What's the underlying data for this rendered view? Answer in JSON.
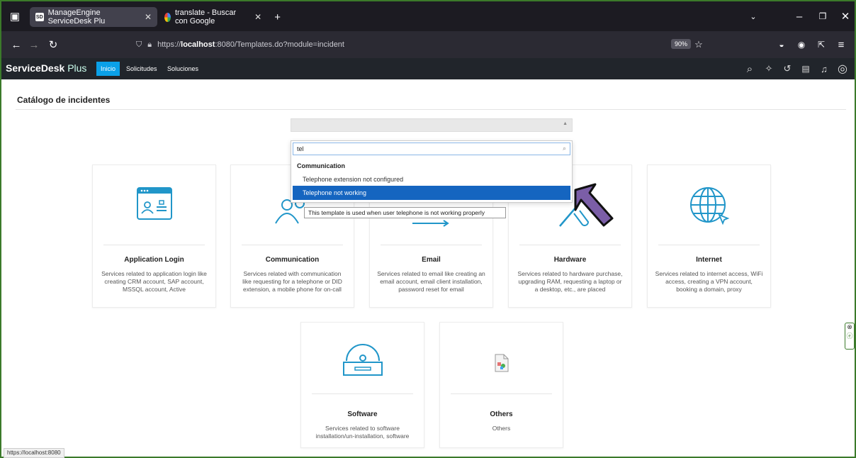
{
  "browser": {
    "tabs": [
      {
        "label": "ManageEngine ServiceDesk Plu",
        "favicon": "SD"
      },
      {
        "label": "translate - Buscar con Google"
      }
    ],
    "url_prefix": "https://",
    "url_host": "localhost",
    "url_rest": ":8080/Templates.do?module=incident",
    "zoom": "90%",
    "status_url": "https://localhost:8080"
  },
  "app": {
    "brand": "ServiceDesk",
    "brand_suffix": "Plus",
    "menu": [
      "Inicio",
      "Solicitudes",
      "Soluciones"
    ]
  },
  "page": {
    "title": "Catálogo de incidentes"
  },
  "dropdown": {
    "search_value": "tel",
    "group": "Communication",
    "options": [
      "Telephone extension not configured",
      "Telephone not working"
    ],
    "selected_index": 1,
    "tooltip": "This template is used when user telephone is not working properly"
  },
  "cards": [
    {
      "title": "Application Login",
      "desc": "Services related to application login like creating CRM account, SAP account, MSSQL account, Active",
      "icon": "app-login-icon"
    },
    {
      "title": "Communication",
      "desc": "Services related with communication like requesting for a telephone or DID extension, a mobile phone for on-call",
      "icon": "users-icon"
    },
    {
      "title": "Email",
      "desc": "Services related to email like creating an email account, email client installation, password reset for email",
      "icon": "email-icon"
    },
    {
      "title": "Hardware",
      "desc": "Services related to hardware purchase, upgrading RAM, requesting a laptop or a desktop, etc., are placed",
      "icon": "tools-icon"
    },
    {
      "title": "Internet",
      "desc": "Services related to internet access, WiFi access, creating a VPN account, booking a domain, proxy",
      "icon": "globe-icon"
    },
    {
      "title": "Software",
      "desc": "Services related to software installation/un-installation, software",
      "icon": "disc-drive-icon"
    },
    {
      "title": "Others",
      "desc": "Others",
      "icon": "broken-image-icon"
    }
  ],
  "colors": {
    "accent": "#0aa0e8",
    "selected": "#1565c0",
    "arrow": "#7b5ea7"
  }
}
